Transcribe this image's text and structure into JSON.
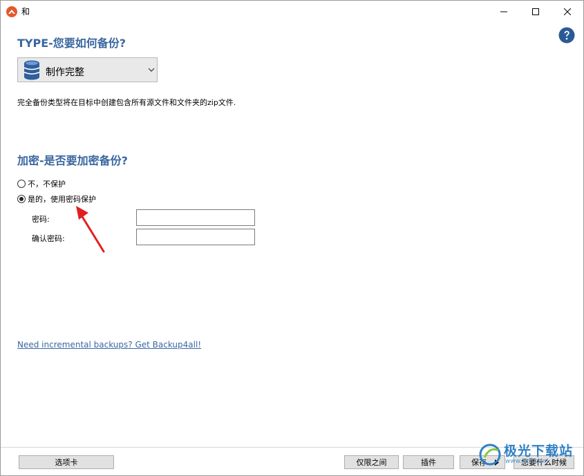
{
  "window": {
    "title": "和"
  },
  "colors": {
    "accent": "#3a67a0",
    "app_icon": "#e25a2b",
    "annotation": "#e02020"
  },
  "icons": {
    "app": "app-logo-icon",
    "help": "help-icon",
    "database": "database-icon",
    "chevron": "chevron-down-icon"
  },
  "type_section": {
    "title": "TYPE-您要如何备份?",
    "dropdown_value": "制作完整",
    "description": "完全备份类型将在目标中创建包含所有源文件和文件夹的zip文件."
  },
  "encrypt_section": {
    "title": "加密-是否要加密备份?",
    "option_no": "不，不保护",
    "option_yes": "是的，使用密码保护",
    "selected": "yes",
    "password_label": "密码:",
    "confirm_label": "确认密码:",
    "password_value": "",
    "confirm_value": ""
  },
  "link": {
    "text": "Need incremental backups? Get Backup4all!"
  },
  "footer": {
    "tabs_button": "选项卡",
    "only_between_button": "仅限之间",
    "plugins_button": "插件",
    "save_button": "保存",
    "when_button": "您要什么时候"
  },
  "watermark": {
    "text": "极光下载站",
    "url": "www.xz7.com"
  }
}
